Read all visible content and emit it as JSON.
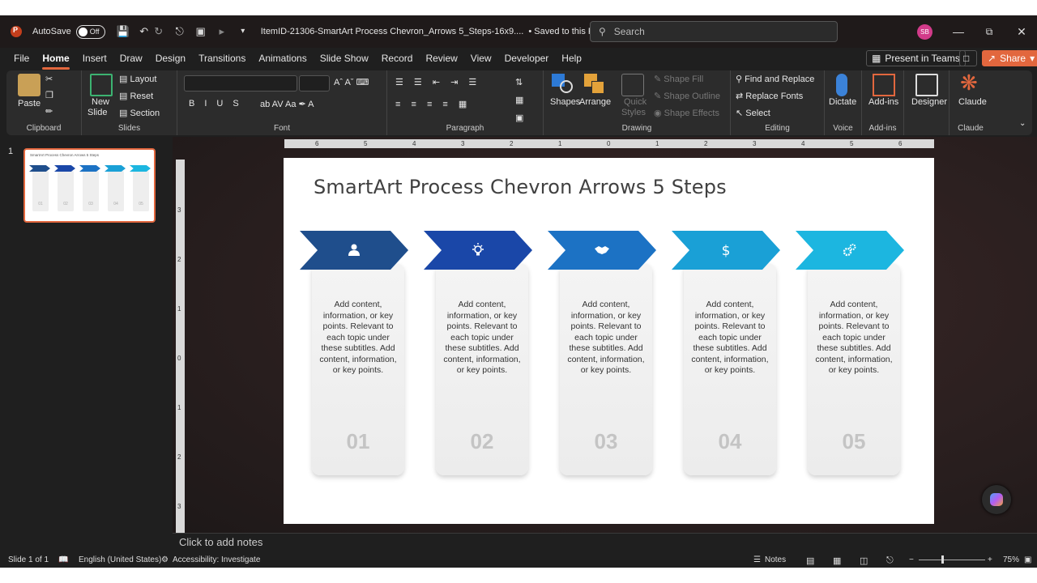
{
  "titlebar": {
    "autosave_label": "AutoSave",
    "autosave_state": "Off",
    "filename": "ItemID-21306-SmartArt Process Chevron_Arrows 5_Steps-16x9....",
    "save_status": "• Saved to this PC",
    "search_placeholder": "Search",
    "user_initials": "SB"
  },
  "menu": {
    "items": [
      "File",
      "Home",
      "Insert",
      "Draw",
      "Design",
      "Transitions",
      "Animations",
      "Slide Show",
      "Record",
      "Review",
      "View",
      "Developer",
      "Help"
    ],
    "present_teams": "Present in Teams",
    "share": "Share"
  },
  "ribbon": {
    "clipboard": {
      "paste": "Paste",
      "label": "Clipboard"
    },
    "slides": {
      "new_slide": "New",
      "new_slide2": "Slide",
      "layout": "Layout",
      "reset": "Reset",
      "section": "Section",
      "label": "Slides"
    },
    "font": {
      "label": "Font"
    },
    "paragraph": {
      "label": "Paragraph"
    },
    "drawing": {
      "shapes": "Shapes",
      "arrange": "Arrange",
      "quick_styles": "Quick",
      "quick_styles2": "Styles",
      "shape_fill": "Shape Fill",
      "shape_outline": "Shape Outline",
      "shape_effects": "Shape Effects",
      "label": "Drawing"
    },
    "editing": {
      "find_replace": "Find and Replace",
      "replace_fonts": "Replace Fonts",
      "select": "Select",
      "label": "Editing"
    },
    "voice": {
      "dictate": "Dictate",
      "label": "Voice"
    },
    "addins": {
      "addins": "Add-ins",
      "label": "Add-ins"
    },
    "designer": {
      "designer": "Designer"
    },
    "claude": {
      "claude": "Claude",
      "label": "Claude"
    }
  },
  "thumbnail": {
    "number": "1",
    "title": "SmartArt Process Chevron Arrows 5 Steps"
  },
  "slide": {
    "title": "SmartArt Process Chevron Arrows 5 Steps",
    "steps": [
      {
        "icon": "person-icon",
        "number": "01",
        "color": "#1f4e8c",
        "text": "Add content, information, or key points. Relevant to each topic under these subtitles. Add content, information, or key points."
      },
      {
        "icon": "lightbulb-icon",
        "number": "02",
        "color": "#1a47a8",
        "text": "Add content, information, or key points. Relevant to each topic under these subtitles. Add content, information, or key points."
      },
      {
        "icon": "handshake-icon",
        "number": "03",
        "color": "#1c72c4",
        "text": "Add content, information, or key points. Relevant to each topic under these subtitles. Add content, information, or key points."
      },
      {
        "icon": "dollar-icon",
        "number": "04",
        "color": "#1aa0d6",
        "text": "Add content, information, or key points. Relevant to each topic under these subtitles. Add content, information, or key points."
      },
      {
        "icon": "gears-icon",
        "number": "05",
        "color": "#1cb6e0",
        "text": "Add content, information, or key points. Relevant to each topic under these subtitles. Add content, information, or key points."
      }
    ]
  },
  "notes_placeholder": "Click to add notes",
  "status": {
    "slide": "Slide 1 of 1",
    "language": "English (United States)",
    "accessibility": "Accessibility: Investigate",
    "notes": "Notes",
    "zoom": "75%"
  }
}
